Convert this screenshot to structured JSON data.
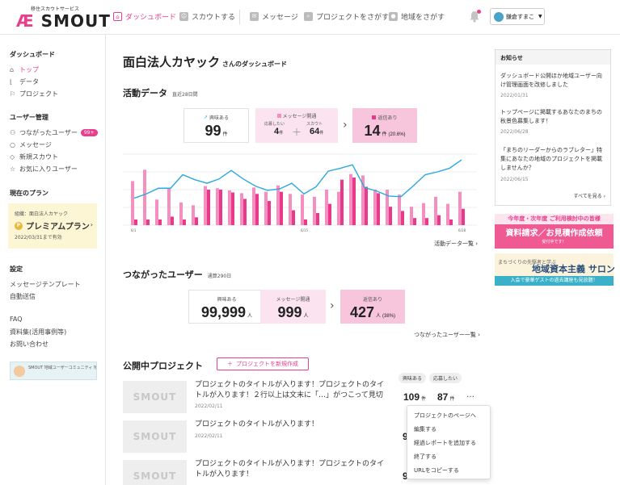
{
  "header": {
    "logo_sub": "移住スカウトサービス",
    "logo_mark": "Æ",
    "logo_word": "SMOUT",
    "nav": [
      {
        "label": "ダッシュボード",
        "icon": "home-icon"
      },
      {
        "label": "スカウトする",
        "icon": "scout-icon"
      },
      {
        "label": "メッセージ",
        "icon": "message-icon"
      },
      {
        "label": "プロジェクトをさがす",
        "icon": "search-icon"
      },
      {
        "label": "地域をさがす",
        "icon": "map-pin-icon"
      }
    ],
    "user": "鎌倉すまこ",
    "accent": "#e83e8c"
  },
  "sidebar": {
    "dashboard_heading": "ダッシュボード",
    "dash_items": [
      "トップ",
      "データ",
      "プロジェクト"
    ],
    "users_heading": "ユーザー管理",
    "user_items": [
      "つながったユーザー",
      "メッセージ",
      "新規スカウト",
      "お気に入りユーザー"
    ],
    "badge": "99+",
    "plan_heading": "現在のプラン",
    "plan_org": "組織：面白法人カヤック",
    "plan_name": "プレミアムプラン",
    "plan_badge": "P",
    "plan_until": "2022/03/31まで有効",
    "settings_heading": "設定",
    "settings_items": [
      "メッセージテンプレート",
      "自動送信"
    ],
    "faq": "FAQ",
    "docs": "資料集(活用事例等)",
    "contact": "お問い合わせ",
    "banner": "SMOUT 地域ユーザーコミュニティ 地域部屋"
  },
  "page": {
    "title": "面白法人カヤック",
    "title_suffix": "さんのダッシュボード"
  },
  "activity": {
    "heading": "活動データ",
    "period": "直近28日間",
    "interest_label": "興味ある",
    "interest_value": "99",
    "unit": "件",
    "msg_label": "メッセージ開通",
    "apply_label": "応募したい",
    "apply_value": "4",
    "scout_label": "スカウト",
    "scout_value": "64",
    "plus": "＋",
    "reply_label": "返信あり",
    "reply_value": "14",
    "reply_pct": "(20.6%)",
    "link": "活動データ一覧"
  },
  "chart_data": {
    "type": "bar",
    "x_ticks": [
      "6/1",
      "6/15",
      "6/28"
    ],
    "series": [
      {
        "type": "bar",
        "color": "#f48fbf",
        "values": [
          62,
          78,
          36,
          52,
          32,
          28,
          55,
          52,
          49,
          45,
          53,
          47,
          56,
          44,
          43,
          40,
          50,
          47,
          72,
          70,
          50,
          50,
          43,
          26,
          31,
          40,
          30,
          47
        ]
      },
      {
        "type": "bar",
        "color": "#e8398a",
        "values": [
          8,
          8,
          8,
          12,
          8,
          11,
          50,
          50,
          46,
          37,
          44,
          34,
          47,
          21,
          8,
          17,
          30,
          64,
          67,
          54,
          45,
          26,
          20,
          10,
          10,
          14,
          8,
          23
        ]
      },
      {
        "type": "line",
        "color": "#29a9e1",
        "values": [
          38,
          44,
          52,
          52,
          71,
          64,
          59,
          65,
          77,
          65,
          55,
          49,
          51,
          59,
          44,
          54,
          76,
          80,
          85,
          53,
          48,
          41,
          40,
          55,
          71,
          75,
          80,
          92
        ]
      }
    ]
  },
  "connected": {
    "heading": "つながったユーザー",
    "period": "通算290日",
    "interest_label": "興味ある",
    "interest_value": "99,999",
    "interest_unit": "人",
    "msg_label": "メッセージ開通",
    "msg_value": "999",
    "msg_unit": "人",
    "reply_label": "返信あり",
    "reply_value": "427",
    "reply_unit": "人",
    "reply_pct": "(38%)",
    "link": "つながったユーザー一覧"
  },
  "projects": {
    "heading": "公開中プロジェクト",
    "new_button": "プロジェクトを新規作成",
    "col_interest": "興味ある",
    "col_apply": "応募したい",
    "thumb_word": "SMOUT",
    "unit": "件",
    "more": "…",
    "items": [
      {
        "title": "プロジェクトのタイトルが入ります！プロジェクトのタイトルが入ります！２行以上は文末に「…」がつこって見切れる…",
        "date": "2022/02/11",
        "interest": "109",
        "apply": "87"
      },
      {
        "title": "プロジェクトのタイトルが入ります！",
        "date": "2022/02/11",
        "interest": "9",
        "apply": ""
      },
      {
        "title": "プロジェクトのタイトルが入ります！プロジェクトのタイトルが入ります！",
        "date": "2022/02/11",
        "interest": "9",
        "apply": ""
      }
    ],
    "menu": [
      "プロジェクトのページへ",
      "編集する",
      "経過レポートを追加する",
      "終了する",
      "URLをコピーする"
    ]
  },
  "notices": {
    "heading": "お知らせ",
    "items": [
      {
        "text": "ダッシュボード公開ほか地域ユーザー向け管理画面を改修しました",
        "date": "2022/01/31"
      },
      {
        "text": "トップページに掲載するあなたのまちの秋景色募集します！",
        "date": "2022/06/28"
      },
      {
        "text": "「まちのリーダーからのラブレター」特集にあなたの地域のプロジェクトを掲載しませんか？",
        "date": "2022/06/15"
      }
    ],
    "see_all": "すべてを見る"
  },
  "banners": {
    "b1_top": "今年度・次年度 ご利用検討中の皆様",
    "b1_mid": "資料請求／お見積作成依頼",
    "b1_bot": "受付中です！",
    "b2_top": "まちづくりの先駆者と学ぶ",
    "b2_mid": "地域資本主義 サロン",
    "b2_bot": "入会で豪華ゲストの過去講座も見放題！"
  }
}
